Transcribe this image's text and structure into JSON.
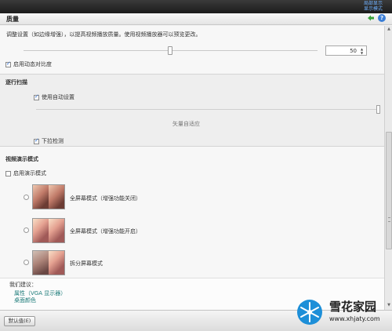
{
  "header": {
    "title": "质量",
    "top_links": [
      "局部显示",
      "显示模式"
    ]
  },
  "content": {
    "description": "调整设置（如边缘增强），以提高视频播放质量。使用视频播放器可以预览更改。",
    "spin_value": "50",
    "dynamic_contrast_label": "启用动态对比度",
    "scan_section": {
      "title": "逐行扫描",
      "auto_setting_label": "使用自动设置",
      "center_label": "矢量自适应",
      "pulldown_label": "下拉检测"
    },
    "demo_section": {
      "title": "视频演示模式",
      "enable_label": "启用演示模式",
      "options": [
        {
          "label": "全屏幕模式（增强功能关闭）"
        },
        {
          "label": "全屏幕模式（增强功能开启）"
        },
        {
          "label": "拆分屏幕模式"
        }
      ]
    },
    "suggest": {
      "title": "我们建议：",
      "links": [
        "属性（VGA 显示器）",
        "桌面颜色"
      ]
    }
  },
  "footer": {
    "default_button": "默认值(E)"
  },
  "watermark": {
    "cn": "雪花家园",
    "url": "www.xhjaty.com"
  },
  "colors": {
    "link": "#1a7a78",
    "accent_check": "#2a6ad0"
  }
}
